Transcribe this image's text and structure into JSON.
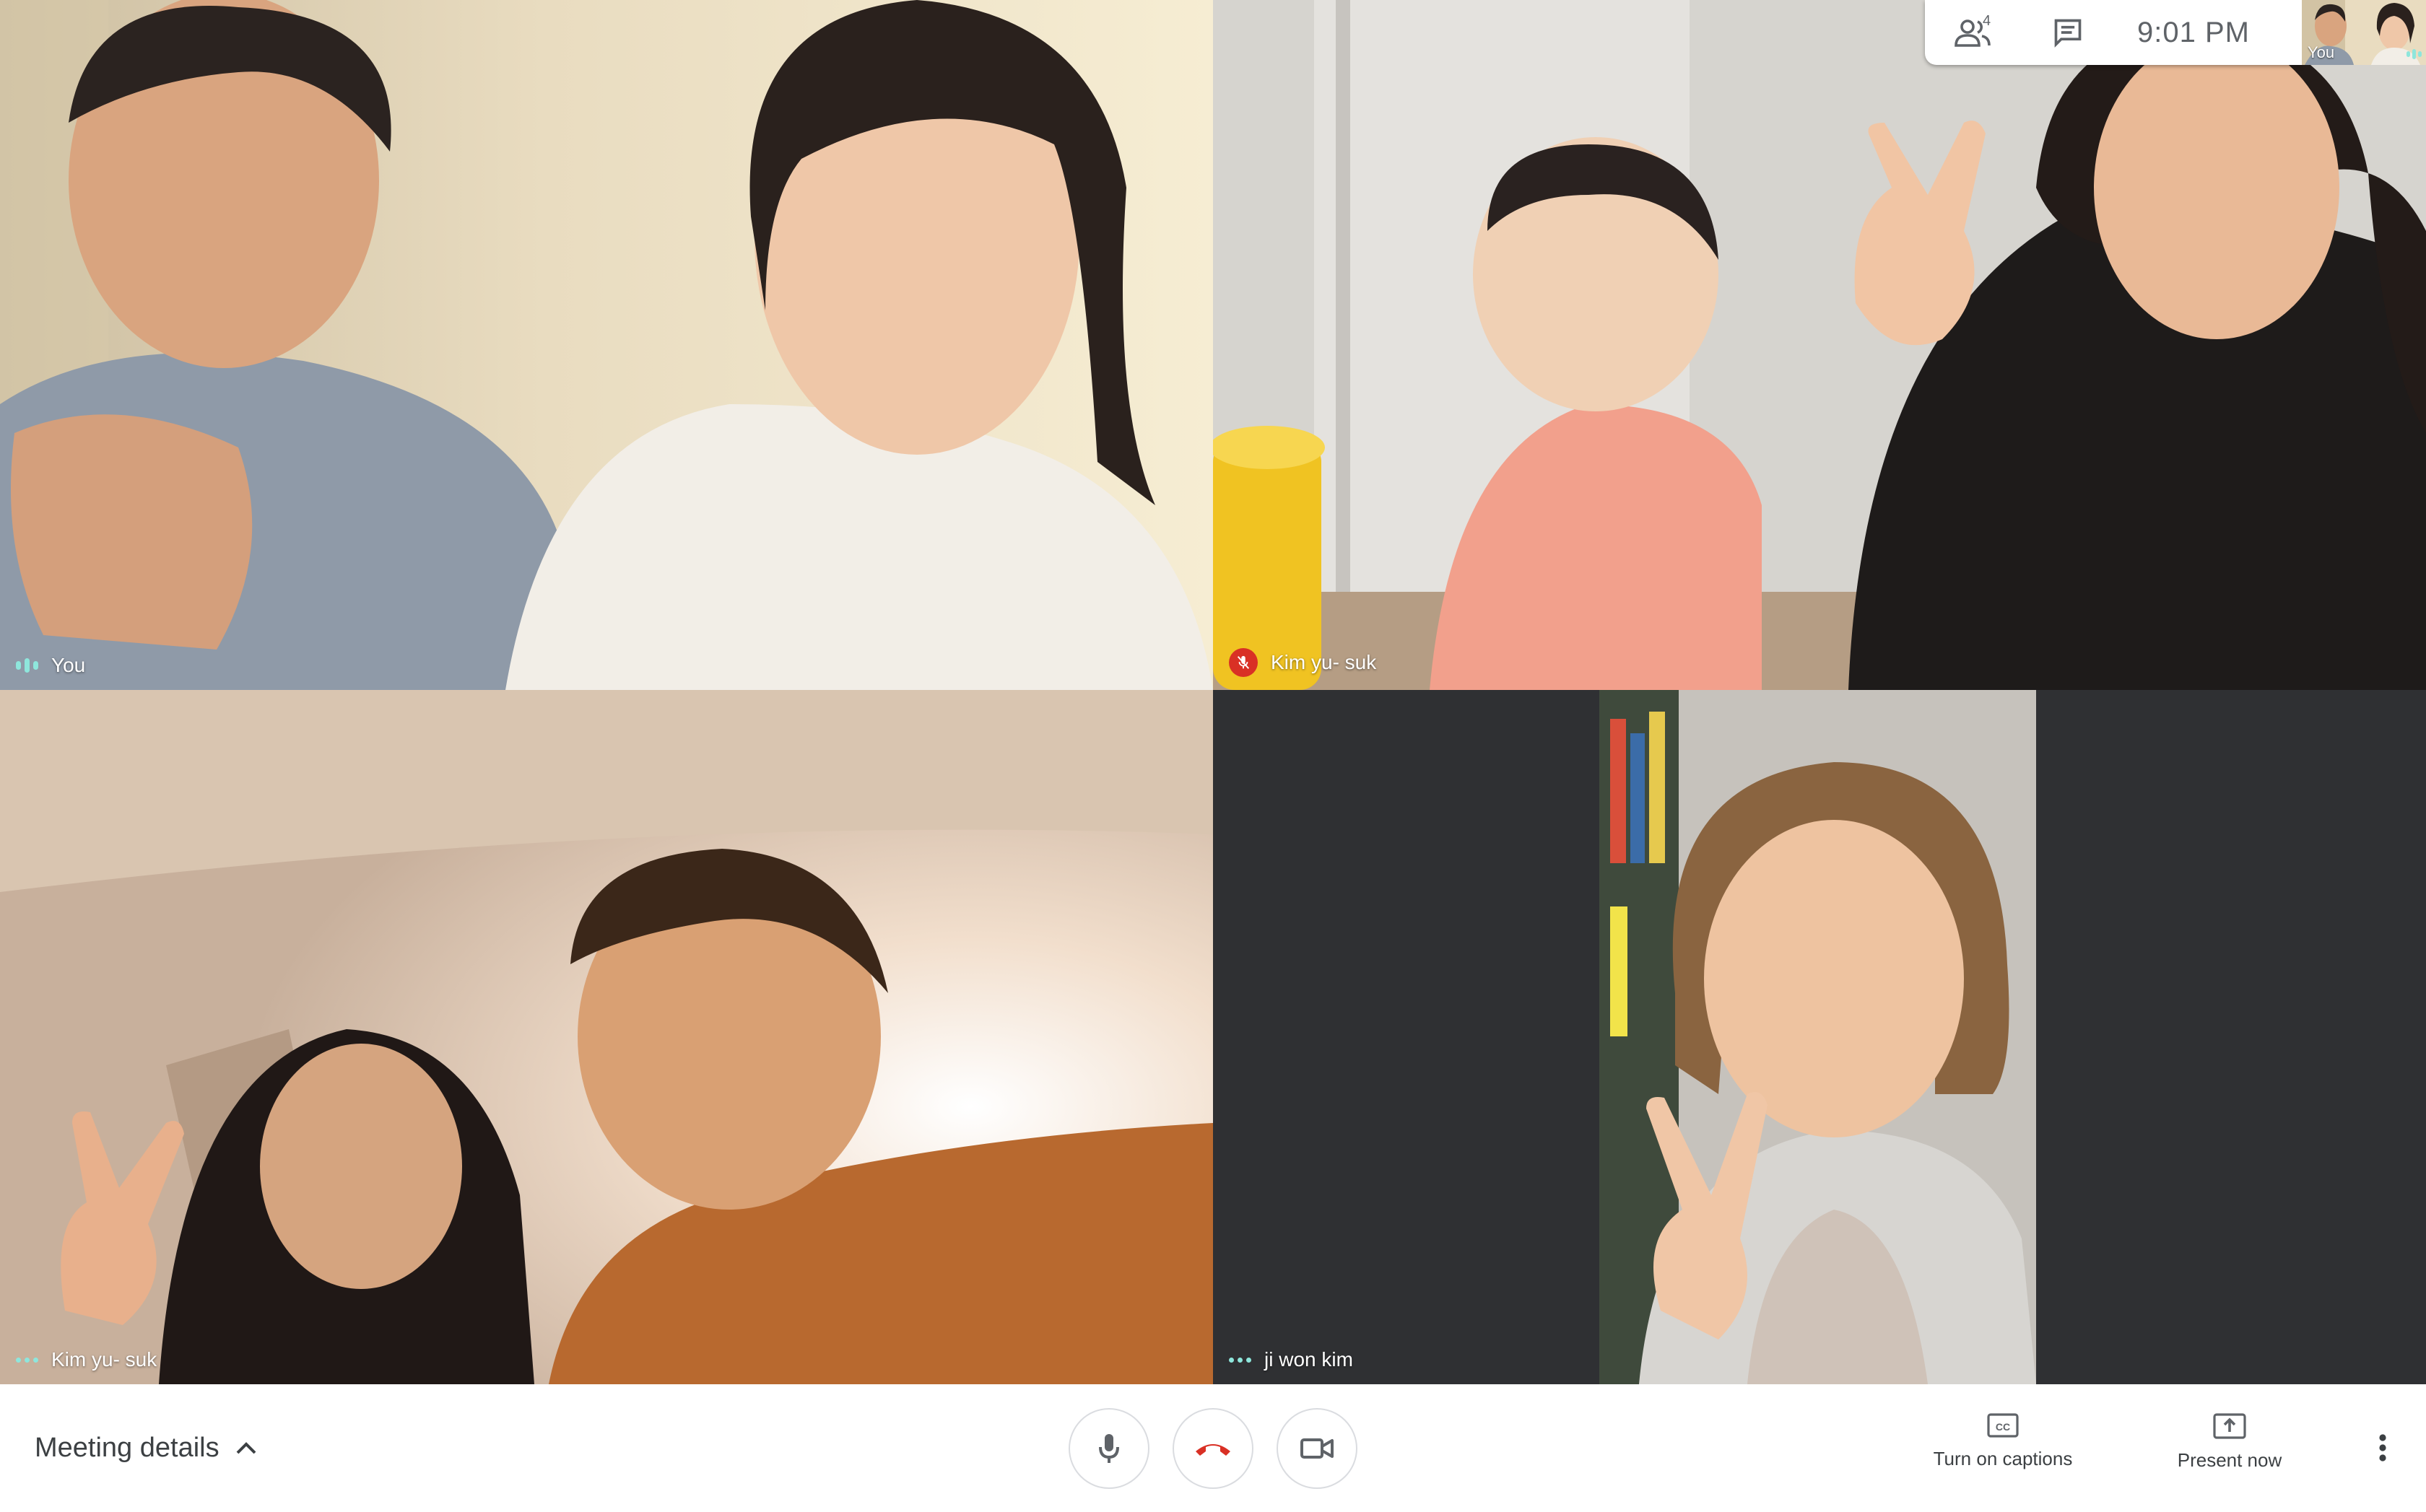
{
  "tiles": [
    {
      "name": "You",
      "status": "speaking"
    },
    {
      "name": "Kim yu- suk",
      "status": "muted"
    },
    {
      "name": "Kim yu- suk",
      "status": "connected"
    },
    {
      "name": "ji won kim",
      "status": "connected"
    }
  ],
  "info_bar": {
    "participant_count": "4",
    "time": "9:01  PM",
    "icons": [
      "people-icon",
      "chat-icon"
    ]
  },
  "self_view": {
    "label": "You"
  },
  "controls": {
    "meeting_details": "Meeting details",
    "captions": "Turn on captions",
    "present": "Present now",
    "icons": [
      "microphone-icon",
      "hang-up-icon",
      "camera-icon",
      "closed-captions-icon",
      "present-screen-icon",
      "more-options-icon",
      "chevron-up-icon"
    ]
  },
  "colors": {
    "hangup_red": "#d93025",
    "audio_teal": "#8ee6dc",
    "empty_tile_bg": "#2f3033",
    "bar_white": "#ffffff",
    "icon_gray": "#5f6368"
  }
}
